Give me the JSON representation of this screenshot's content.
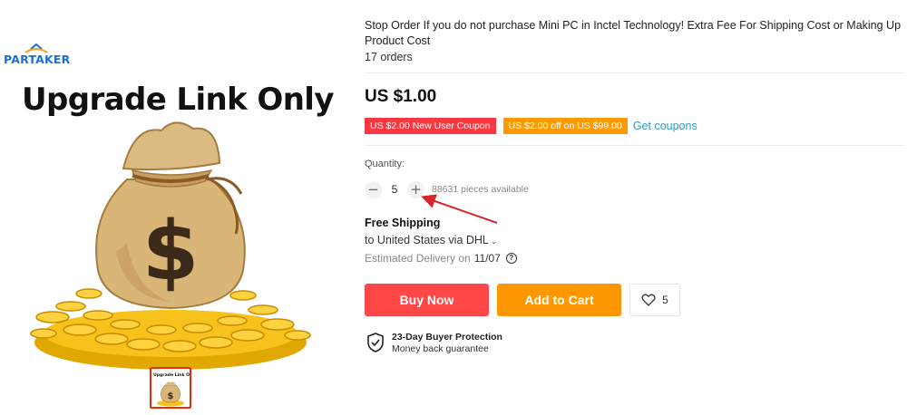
{
  "gallery": {
    "brand": "PARTAKER",
    "hero_caption": "Upgrade Link Only",
    "thumbnail_caption": "Upgrade Link Only",
    "bag_symbol": "$"
  },
  "product": {
    "title": "Stop Order If you do not purchase Mini PC in Inctel Technology! Extra Fee For Shipping Cost or Making Up Product Cost",
    "orders": "17 orders",
    "price": "US $1.00"
  },
  "coupons": {
    "new_user": "US $2.00 New User Coupon",
    "threshold": "US $2.00 off on US $99.00",
    "get_coupons": "Get coupons"
  },
  "quantity": {
    "label": "Quantity:",
    "value": "5",
    "minus": "−",
    "plus": "+",
    "available": "88631 pieces available"
  },
  "shipping": {
    "title": "Free Shipping",
    "destination": "to United States via DHL",
    "delivery_label": "Estimated Delivery on",
    "delivery_date": "11/07",
    "help": "?"
  },
  "actions": {
    "buy_now": "Buy Now",
    "add_to_cart": "Add to Cart",
    "wishlist_count": "5"
  },
  "protection": {
    "title": "23-Day Buyer Protection",
    "subtitle": "Money back guarantee"
  },
  "colors": {
    "buy_now": "#ff4747",
    "add_to_cart": "#ff9800",
    "coupon_red": "#fb3742",
    "coupon_orange": "#ff9b00",
    "link": "#2e9cc3",
    "annotation_arrow": "#d9262b"
  },
  "icons": [
    "partaker-logo",
    "money-bag-icon",
    "minus-icon",
    "plus-icon",
    "chevron-down-icon",
    "help-icon",
    "heart-icon",
    "shield-check-icon"
  ]
}
